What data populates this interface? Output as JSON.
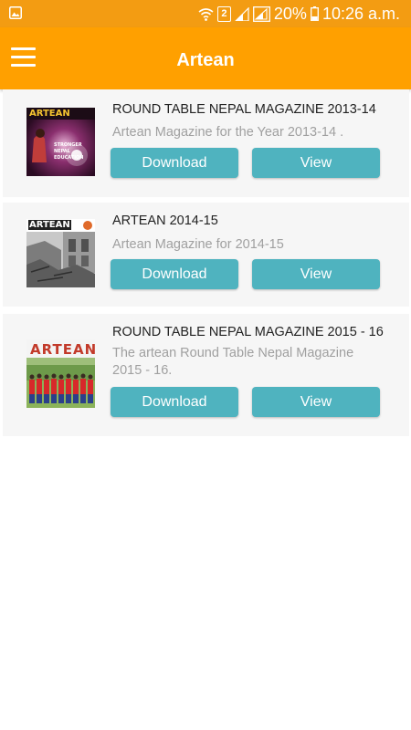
{
  "status_bar": {
    "sim_slot": "2",
    "battery": "20%",
    "time": "10:26 a.m."
  },
  "app_bar": {
    "title": "Artean",
    "menu_icon": "hamburger-menu-icon"
  },
  "magazines": [
    {
      "title": "ROUND TABLE NEPAL MAGAZINE 2013-14",
      "description": "Artean Magazine for the Year 2013-14 .",
      "download_label": "Download",
      "view_label": "View",
      "cover": {
        "masthead": "ARTEAN",
        "headline_1": "STRONGER",
        "headline_2": "NEPAL",
        "headline_3": "EDUCATION"
      }
    },
    {
      "title": "ARTEAN 2014-15",
      "description": "Artean Magazine for 2014-15",
      "download_label": "Download",
      "view_label": "View",
      "cover": {
        "masthead": "ARTEAN"
      }
    },
    {
      "title": "ROUND TABLE NEPAL MAGAZINE 2015 - 16",
      "description": "The artean Round Table Nepal Magazine 2015 - 16.",
      "download_label": "Download",
      "view_label": "View",
      "cover": {
        "masthead": "ARTEAN"
      }
    }
  ],
  "colors": {
    "status_bar": "#F39C12",
    "app_bar": "#FFA000",
    "button": "#4FB3BF",
    "card_bg": "#F6F6F6"
  }
}
